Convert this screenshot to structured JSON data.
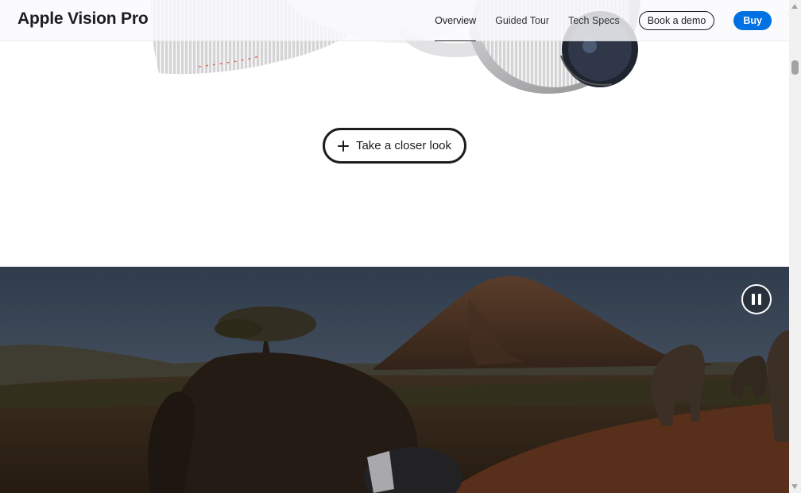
{
  "localnav": {
    "title": "Apple Vision Pro",
    "links": [
      {
        "label": "Overview",
        "active": true
      },
      {
        "label": "Guided Tour",
        "active": false
      },
      {
        "label": "Tech Specs",
        "active": false
      }
    ],
    "demo_label": "Book a demo",
    "buy_label": "Buy"
  },
  "closer_look": {
    "label": "Take a closer look",
    "icon": "plus-icon"
  },
  "video": {
    "control_icon": "pause-icon",
    "state": "playing"
  },
  "colors": {
    "accent_blue": "#0071e3",
    "text_dark": "#1d1d1f",
    "nav_bg": "#fafafc"
  }
}
